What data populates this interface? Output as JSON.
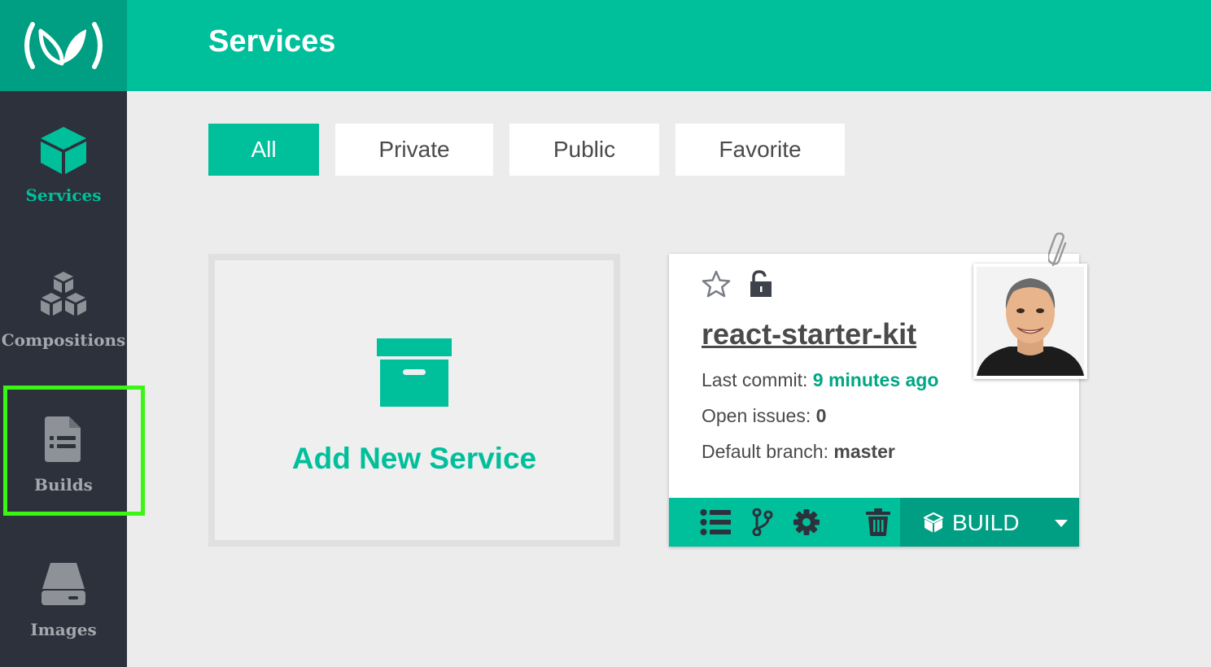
{
  "header": {
    "title": "Services"
  },
  "sidebar": {
    "items": [
      {
        "id": "services",
        "label": "Services",
        "icon": "cube-icon",
        "active": true
      },
      {
        "id": "compositions",
        "label": "Compositions",
        "icon": "stacked-cubes-icon",
        "active": false
      },
      {
        "id": "builds",
        "label": "Builds",
        "icon": "document-list-icon",
        "active": false
      },
      {
        "id": "images",
        "label": "Images",
        "icon": "hard-drive-icon",
        "active": false
      }
    ]
  },
  "filters": [
    {
      "label": "All",
      "active": true
    },
    {
      "label": "Private",
      "active": false
    },
    {
      "label": "Public",
      "active": false
    },
    {
      "label": "Favorite",
      "active": false
    }
  ],
  "add_card": {
    "label": "Add New Service",
    "icon": "archive-box-icon"
  },
  "service": {
    "name": "react-starter-kit",
    "commit_label": "Last commit: ",
    "commit_value": "9 minutes ago",
    "issues_label": "Open issues: ",
    "issues_value": "0",
    "branch_label": "Default branch: ",
    "branch_value": "master",
    "favorite": false,
    "locked": false,
    "build_label": "BUILD"
  },
  "colors": {
    "primary": "#00bf9b",
    "primary_dark": "#009e83",
    "sidebar_bg": "#2c313c",
    "highlight": "#3bf514",
    "background": "#ececec"
  }
}
